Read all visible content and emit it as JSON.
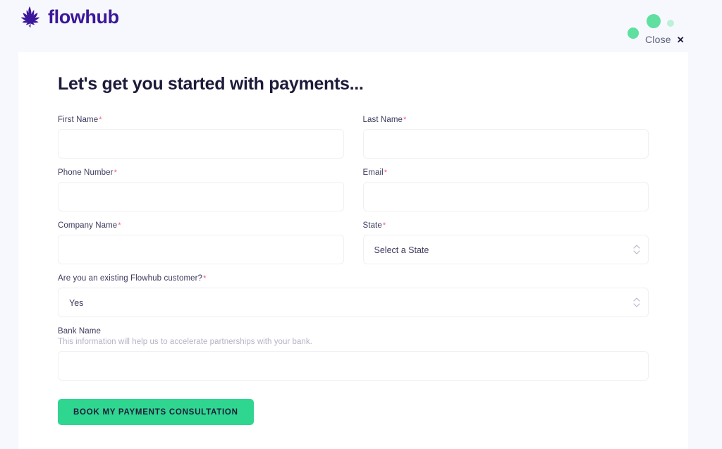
{
  "brand": {
    "name": "flowhub",
    "logo_icon": "cannabis-leaf-icon",
    "logo_color": "#3b179b",
    "accent_color": "#2fd690",
    "required_color": "#f7567c",
    "text_color": "#1c1b3a"
  },
  "topbar": {
    "close_label": "Close",
    "close_icon": "close-x-icon",
    "dots": [
      {
        "name": "decorative-dot-small-left",
        "color": "#5fdfa0"
      },
      {
        "name": "decorative-dot-large",
        "color": "#5fdfa0"
      },
      {
        "name": "decorative-dot-faded",
        "color": "#bdf0d8"
      }
    ]
  },
  "main": {
    "title": "Let's get you started with payments...",
    "form": {
      "fields": [
        {
          "key": "first_name",
          "label": "First Name",
          "required": true,
          "type": "text",
          "value": "",
          "placeholder": ""
        },
        {
          "key": "last_name",
          "label": "Last Name",
          "required": true,
          "type": "text",
          "value": "",
          "placeholder": ""
        },
        {
          "key": "phone_number",
          "label": "Phone Number",
          "required": true,
          "type": "text",
          "value": "",
          "placeholder": ""
        },
        {
          "key": "email",
          "label": "Email",
          "required": true,
          "type": "text",
          "value": "",
          "placeholder": ""
        },
        {
          "key": "company_name",
          "label": "Company Name",
          "required": true,
          "type": "text",
          "value": "",
          "placeholder": ""
        },
        {
          "key": "state",
          "label": "State",
          "required": true,
          "type": "select",
          "value": "Select a State"
        },
        {
          "key": "existing_customer",
          "label": "Are you an existing Flowhub customer?",
          "required": true,
          "type": "select",
          "value": "Yes"
        },
        {
          "key": "bank_name",
          "label": "Bank Name",
          "required": false,
          "type": "text",
          "helper": "This information will help us to accelerate partnerships with your bank.",
          "value": "",
          "placeholder": ""
        }
      ],
      "required_marker": "*",
      "submit_label": "BOOK MY PAYMENTS CONSULTATION"
    }
  }
}
